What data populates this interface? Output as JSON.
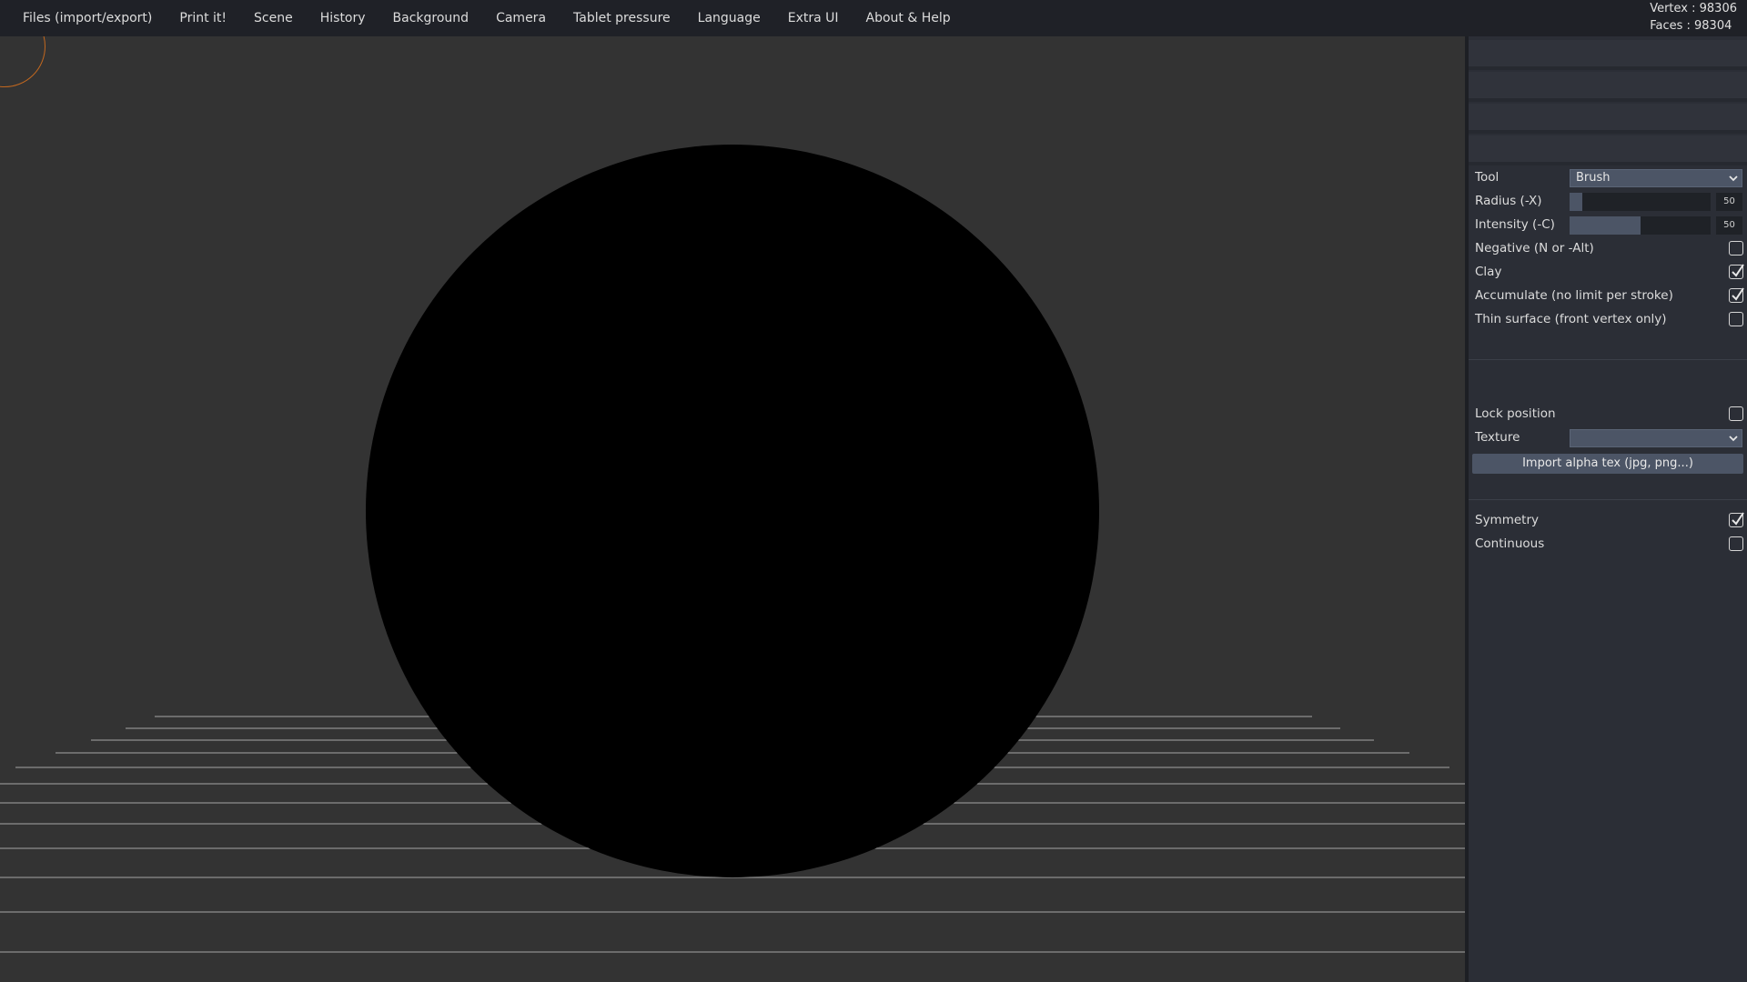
{
  "menu": {
    "items": [
      "Files (import/export)",
      "Print it!",
      "Scene",
      "History",
      "Background",
      "Camera",
      "Tablet pressure",
      "Language",
      "Extra UI",
      "About & Help"
    ]
  },
  "stats": {
    "vertex": "Vertex : 98306",
    "faces": "Faces : 98304"
  },
  "colors": {
    "menubar": "#1f2127",
    "viewport_bg": "#333333",
    "panel_bg": "#2b2e36",
    "control_blue": "#4c5566",
    "cursor_ring": "#c2681f",
    "mesh": "#000000"
  },
  "tools": {
    "tool_label": "Tool",
    "tool_value": "Brush",
    "radius_label": "Radius (-X)",
    "radius_value": "50",
    "radius_fraction": 0.09,
    "intensity_label": "Intensity (-C)",
    "intensity_value": "50",
    "intensity_fraction": 0.5,
    "negative_label": "Negative (N or -Alt)",
    "negative_checked": false,
    "clay_label": "Clay",
    "clay_checked": true,
    "accumulate_label": "Accumulate (no limit per stroke)",
    "accumulate_checked": true,
    "thin_surface_label": "Thin surface (front vertex only)",
    "thin_surface_checked": false
  },
  "texture": {
    "lock_position_label": "Lock position",
    "lock_position_checked": false,
    "texture_label": "Texture",
    "texture_value": "",
    "import_button": "Import alpha tex (jpg, png...)"
  },
  "symmetry": {
    "symmetry_label": "Symmetry",
    "symmetry_checked": true,
    "continuous_label": "Continuous",
    "continuous_checked": false
  }
}
